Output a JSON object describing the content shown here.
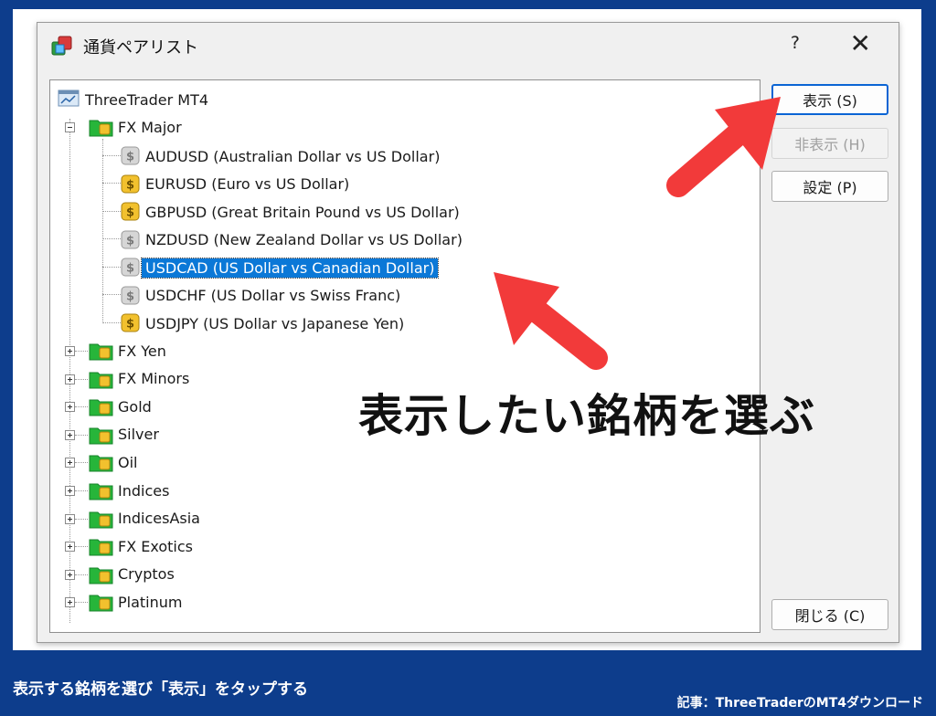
{
  "dialog": {
    "title": "通貨ペアリスト",
    "help_label": "?",
    "close_label": "✕"
  },
  "tree": {
    "root": "ThreeTrader MT4",
    "fx_major": "FX Major",
    "symbols": [
      {
        "label": "AUDUSD  (Australian Dollar vs US Dollar)",
        "active": false
      },
      {
        "label": "EURUSD  (Euro vs US Dollar)",
        "active": true
      },
      {
        "label": "GBPUSD  (Great Britain Pound vs US Dollar)",
        "active": true
      },
      {
        "label": "NZDUSD  (New Zealand Dollar vs US Dollar)",
        "active": false
      },
      {
        "label": "USDCAD  (US Dollar vs Canadian Dollar)",
        "active": false
      },
      {
        "label": "USDCHF  (US Dollar vs Swiss Franc)",
        "active": false
      },
      {
        "label": "USDJPY  (US Dollar vs Japanese Yen)",
        "active": true
      }
    ],
    "groups": [
      "FX Yen",
      "FX Minors",
      "Gold",
      "Silver",
      "Oil",
      "Indices",
      "IndicesAsia",
      "FX Exotics",
      "Cryptos",
      "Platinum"
    ]
  },
  "buttons": {
    "show": "表示 (S)",
    "hide": "非表示 (H)",
    "settings": "設定 (P)",
    "close": "閉じる (C)"
  },
  "annotation": {
    "text": "表示したい銘柄を選ぶ"
  },
  "footer": {
    "caption": "表示する銘柄を選び「表示」をタップする",
    "source": "記事：ThreeTraderのMT4ダウンロード"
  },
  "colors": {
    "background": "#0d3d8c",
    "arrow": "#f23a3a",
    "selection": "#0b78d7",
    "coin_active": "#f2c12e",
    "coin_inactive": "#c8c8c8",
    "folder": "#27b53a"
  },
  "icons": {
    "app": "currency-pairs-icon",
    "root": "terminal-icon",
    "group": "folder-coins-icon",
    "symbol": "dollar-coin-icon"
  }
}
